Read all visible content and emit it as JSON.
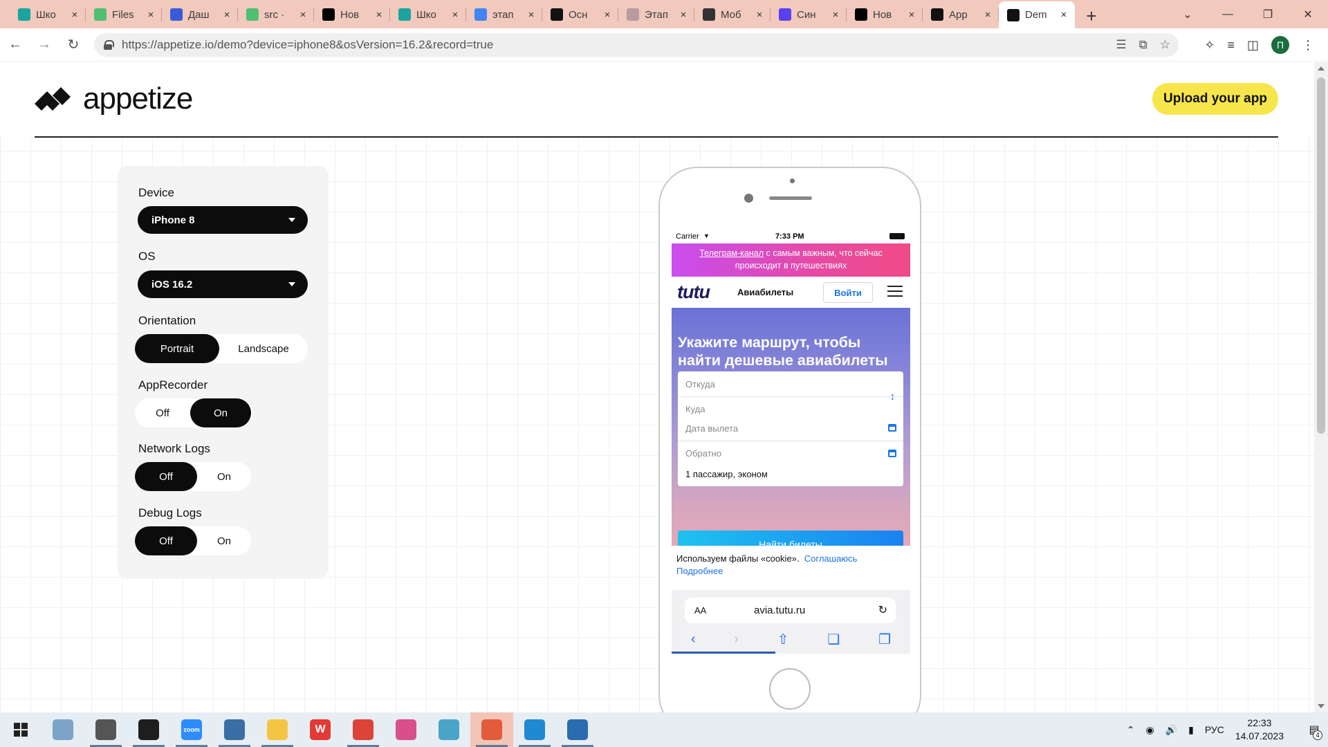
{
  "browser": {
    "tabs": [
      {
        "title": "Шко",
        "icon": "school-icon",
        "color": "#1aa4a0"
      },
      {
        "title": "Files",
        "icon": "files-icon",
        "color": "#4fc070"
      },
      {
        "title": "Даш",
        "icon": "dashboard-icon",
        "color": "#3a5bd9"
      },
      {
        "title": "src ·",
        "icon": "src-icon",
        "color": "#4fc070"
      },
      {
        "title": "Нов",
        "icon": "wikipedia-icon",
        "color": "#000000"
      },
      {
        "title": "Шко",
        "icon": "school-icon",
        "color": "#1aa4a0"
      },
      {
        "title": "этап",
        "icon": "google-icon",
        "color": "#4285f4"
      },
      {
        "title": "Осн",
        "icon": "itproger-icon",
        "color": "#111111"
      },
      {
        "title": "Этап",
        "icon": "page-icon",
        "color": "#b89aa0"
      },
      {
        "title": "Моб",
        "icon": "mobile-icon",
        "color": "#333333"
      },
      {
        "title": "Син",
        "icon": "s-icon",
        "color": "#5b3ff0"
      },
      {
        "title": "Нов",
        "icon": "wikipedia-icon",
        "color": "#000000"
      },
      {
        "title": "App",
        "icon": "appetize-icon",
        "color": "#111111"
      },
      {
        "title": "Dem",
        "icon": "appetize-icon",
        "color": "#111111",
        "active": true
      }
    ],
    "url": "https://appetize.io/demo?device=iphone8&osVersion=16.2&record=true",
    "profile_initial": "П"
  },
  "site": {
    "logo_text": "appetize",
    "upload_label": "Upload your app"
  },
  "config": {
    "device_label": "Device",
    "device_value": "iPhone 8",
    "os_label": "OS",
    "os_value": "iOS 16.2",
    "orientation_label": "Orientation",
    "orientation_options": [
      "Portrait",
      "Landscape"
    ],
    "orientation_selected": "Portrait",
    "apprecorder_label": "AppRecorder",
    "apprecorder_options": [
      "Off",
      "On"
    ],
    "apprecorder_selected": "On",
    "network_label": "Network Logs",
    "network_options": [
      "Off",
      "On"
    ],
    "network_selected": "Off",
    "debug_label": "Debug Logs",
    "debug_options": [
      "Off",
      "On"
    ],
    "debug_selected": "Off"
  },
  "phone": {
    "status": {
      "carrier": "Carrier",
      "time": "7:33 PM"
    },
    "promo_link": "Телеграм-канал",
    "promo_text": " с самым важным, что сейчас происходит в путешествиях",
    "logo": "tutu",
    "section": "Авиабилеты",
    "login": "Войти",
    "hero_title": "Укажите маршрут, чтобы найти дешевые авиабилеты",
    "from_placeholder": "Откуда",
    "to_placeholder": "Куда",
    "depart_placeholder": "Дата вылета",
    "return_placeholder": "Обратно",
    "passengers": "1 пассажир, эконом",
    "search_button": "Найти билеты",
    "cookie_text": "Используем файлы «cookie».",
    "cookie_agree": "Соглашаюсь",
    "cookie_more": "Подробнее",
    "safari_aa": "AA",
    "safari_url": "avia.tutu.ru"
  },
  "taskbar": {
    "apps": [
      {
        "name": "paint-app-icon",
        "color": "#7da3c8",
        "running": false
      },
      {
        "name": "settings-app-icon",
        "color": "#555555",
        "running": true
      },
      {
        "name": "terminal-app-icon",
        "color": "#1e1e1e",
        "running": true
      },
      {
        "name": "zoom-app-icon",
        "color": "#2d8cff",
        "running": true,
        "label": "zoom"
      },
      {
        "name": "calculator-app-icon",
        "color": "#3a6ea5",
        "running": true
      },
      {
        "name": "explorer-app-icon",
        "color": "#f4c542",
        "running": true
      },
      {
        "name": "wps-app-icon",
        "color": "#e53935",
        "running": false,
        "label": "W"
      },
      {
        "name": "chrome-app-icon",
        "color": "#db4437",
        "running": true
      },
      {
        "name": "snipping-app-icon",
        "color": "#d94f8a",
        "running": false
      },
      {
        "name": "notes-app-icon",
        "color": "#4aa3c8",
        "running": false
      },
      {
        "name": "recorder-app-icon",
        "color": "#e25b3a",
        "running": true,
        "active": true
      },
      {
        "name": "vscode-app-icon",
        "color": "#1f8ad2",
        "running": true
      },
      {
        "name": "photos-app-icon",
        "color": "#2b6cb0",
        "running": true
      }
    ],
    "language": "РУС",
    "time": "22:33",
    "date": "14.07.2023",
    "notifications": "4"
  }
}
